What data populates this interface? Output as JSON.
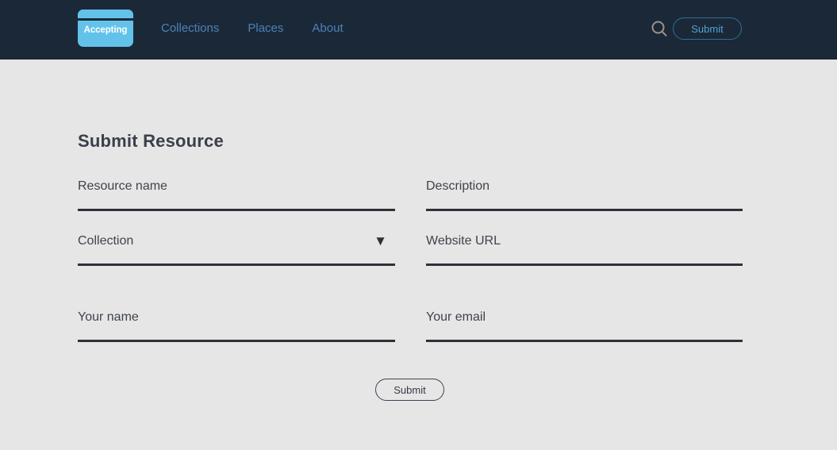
{
  "colors": {
    "header_bg": "#1b2838",
    "page_bg": "#e6e6e6",
    "logo_bg": "#63c2ea",
    "nav_link": "#4b83b5",
    "accent_cyan": "#4fa3d1",
    "rule": "#2e3238",
    "heading": "#3a3f4a"
  },
  "header": {
    "logo": {
      "text": "Accepting",
      "icon": "card-logo-icon"
    },
    "nav": [
      {
        "label": "Collections",
        "name": "nav-link-collections"
      },
      {
        "label": "Places",
        "name": "nav-link-places"
      },
      {
        "label": "About",
        "name": "nav-link-about"
      }
    ],
    "search_icon": "search-icon",
    "submit_label": "Submit"
  },
  "main": {
    "title": "Submit Resource",
    "fields": [
      {
        "name": "resource-name-input",
        "placeholder": "Resource name",
        "value": "",
        "type": "text",
        "column": "left",
        "row": 1
      },
      {
        "name": "description-input",
        "placeholder": "Description",
        "value": "",
        "type": "text",
        "column": "right",
        "row": 1
      },
      {
        "name": "collection-select",
        "placeholder": "Collection",
        "value": "",
        "type": "select",
        "caret": "▼",
        "column": "left",
        "row": 2
      },
      {
        "name": "website-url-input",
        "placeholder": "Website URL",
        "value": "",
        "type": "text",
        "column": "right",
        "row": 2
      },
      {
        "name": "your-name-input",
        "placeholder": "Your name",
        "value": "",
        "type": "text",
        "column": "left",
        "row": 3
      },
      {
        "name": "your-email-input",
        "placeholder": "Your email",
        "value": "",
        "type": "text",
        "column": "right",
        "row": 3
      }
    ],
    "submit_label": "Submit"
  }
}
